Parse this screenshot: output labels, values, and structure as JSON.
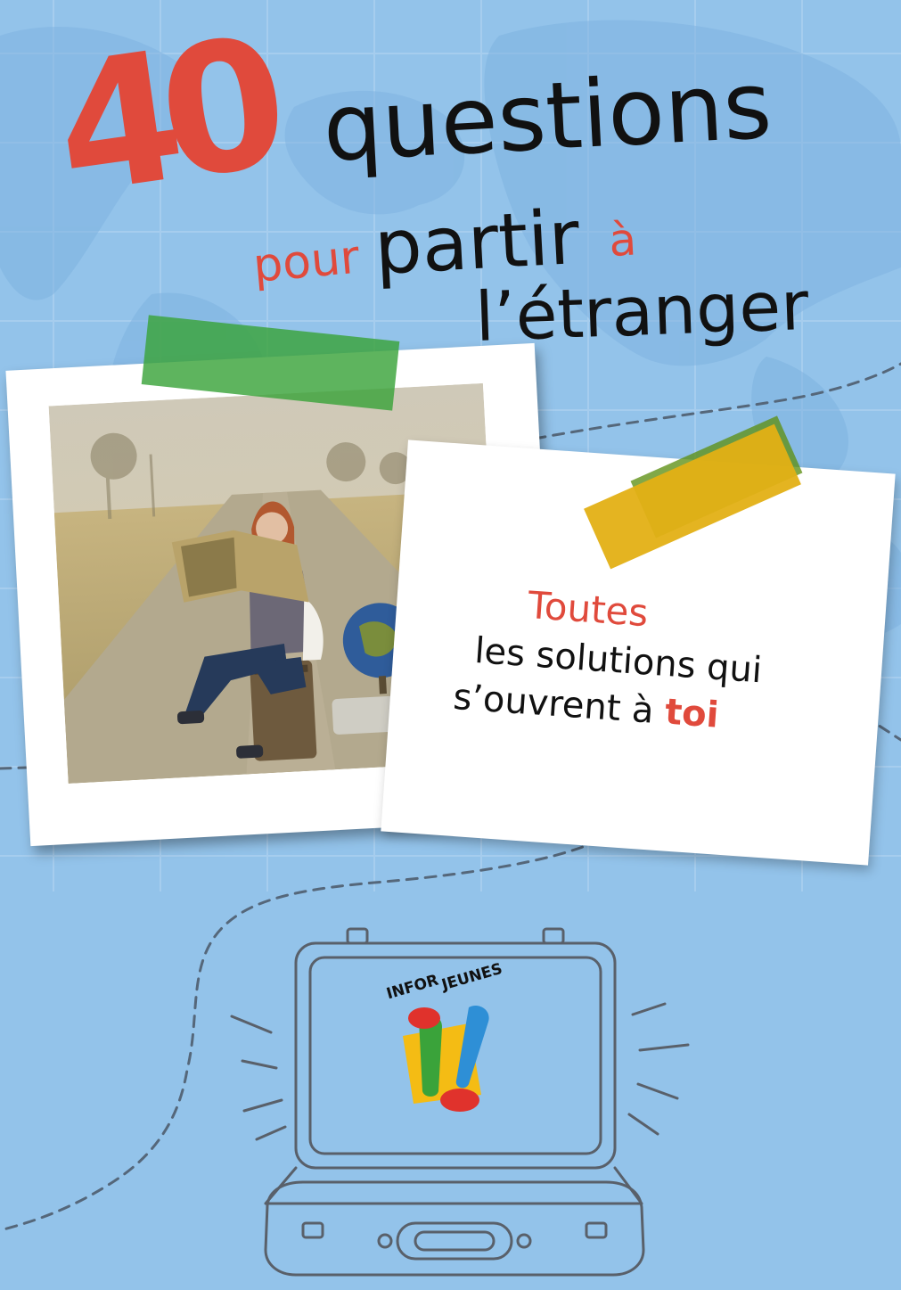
{
  "cover": {
    "number": "40",
    "word_questions": "questions",
    "word_pour": "pour",
    "word_partir": "partir",
    "word_a": "à",
    "word_etranger": "l’étranger"
  },
  "note": {
    "line1": "Toutes",
    "line2": "les solutions qui",
    "line3_start": "s’ouvrent à ",
    "line3_highlight": "toi"
  },
  "logo": {
    "word1": "INFOR",
    "word2": "JEUNES"
  },
  "colors": {
    "background": "#93c3ea",
    "accent_red": "#e04a3c",
    "tape_green": "#3aa33a",
    "tape_yellow": "#e3b015",
    "text_dark": "#111111"
  },
  "icons": {
    "photo": "woman-reading-map-on-suitcase-photo",
    "suitcase": "open-suitcase-outline-icon",
    "logo": "infor-jeunes-exclamation-logo"
  }
}
